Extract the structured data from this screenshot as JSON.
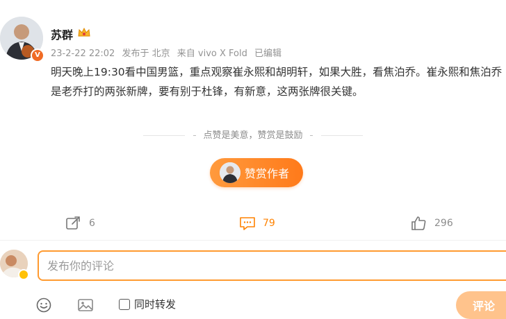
{
  "post": {
    "author": "苏群",
    "timestamp": "23-2-22 22:02",
    "location": "发布于 北京",
    "device": "来自 vivo X Fold",
    "edited": "已编辑",
    "text": "明天晚上19:30看中国男篮，重点观察崔永熙和胡明轩，如果大胜，看焦泊乔。崔永熙和焦泊乔是老乔打的两张新牌，要有别于杜锋，有新意，这两张牌很关键。"
  },
  "reward": {
    "tip": "点赞是美意，赞赏是鼓励",
    "button_label": "赞赏作者"
  },
  "actions": {
    "forward_count": "6",
    "comment_count": "79",
    "like_count": "296"
  },
  "composer": {
    "placeholder": "发布你的评论",
    "sync_label": "同时转发",
    "submit_label": "评论"
  },
  "colors": {
    "accent": "#ff8200",
    "verified_badge": "#f06b25"
  },
  "icons": [
    "crown-icon",
    "verified-icon",
    "forward-icon",
    "comment-icon",
    "like-icon",
    "emoji-icon",
    "image-icon"
  ]
}
